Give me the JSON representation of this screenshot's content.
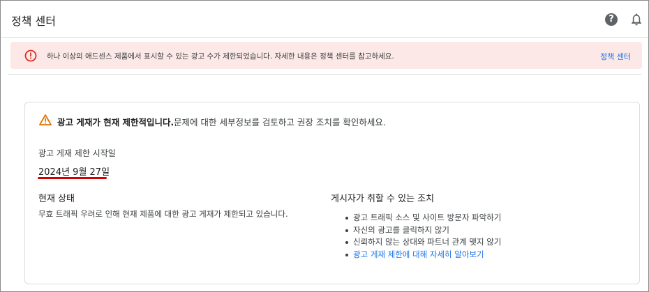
{
  "header": {
    "title": "정책 센터",
    "help_icon_glyph": "?"
  },
  "alert": {
    "message": "하나 이상의 애드센스 제품에서 표시할 수 있는 광고 수가 제한되었습니다. 자세한 내용은 정책 센터를 참고하세요.",
    "link_label": "정책 센터",
    "color": "#d93025"
  },
  "card": {
    "warning_strong": "광고 게재가 현재 제한적입니다.",
    "warning_rest": "문제에 대한 세부정보를 검토하고 권장 조치를 확인하세요.",
    "start_label": "광고 게재 제한 시작일",
    "start_date": "2024년 9월 27일",
    "status_title": "현재 상태",
    "status_text": "무효 트래픽 우려로 인해 현재 제품에 대한 광고 게재가 제한되고 있습니다.",
    "actions_title": "게시자가 취할 수 있는 조치",
    "actions": [
      "광고 트래픽 소스 및 사이트 방문자 파악하기",
      "자신의 광고를 클릭하지 않기",
      "신뢰하지 않는 상대와 파트너 관계 맺지 않기",
      "광고 게재 제한에 대해 자세히 알아보기"
    ],
    "warning_color": "#e37400",
    "link_color": "#1a73e8"
  }
}
